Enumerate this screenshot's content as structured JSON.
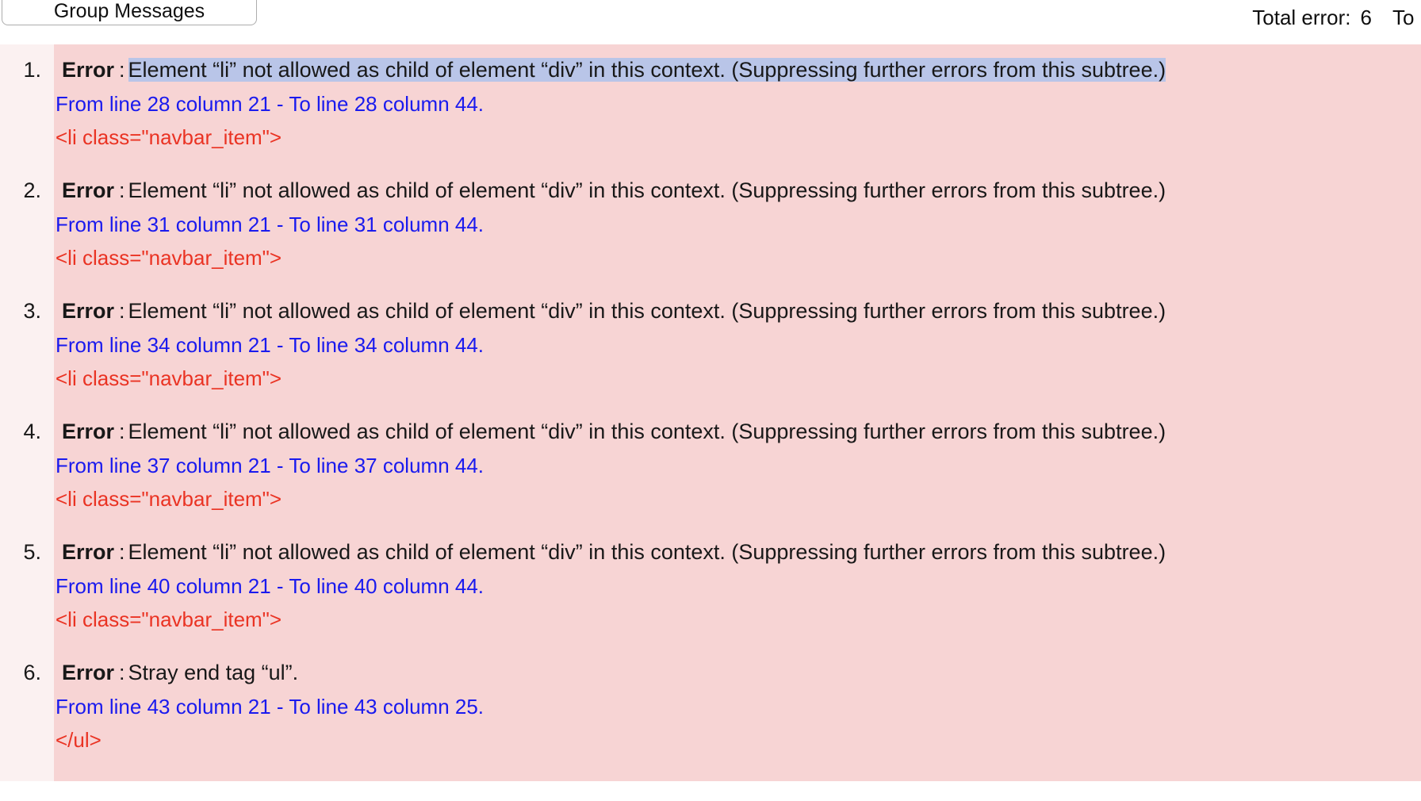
{
  "top_bar": {
    "tab_label": "Group Messages",
    "stats": [
      {
        "label": "Total error:",
        "value": "6"
      },
      {
        "label": "To",
        "value": ""
      }
    ],
    "total_error_label": "Total error:",
    "total_error_value": "6",
    "clipped_stat_label": "To"
  },
  "colors": {
    "error_background": "#f7d4d4",
    "gutter_background": "#fbf1f1",
    "selection_highlight": "#b9c5e8",
    "location_text": "#1a1aee",
    "extract_text": "#ea3323",
    "body_text": "#181818",
    "tab_border": "#adadad"
  },
  "errors": [
    {
      "index": "1.",
      "label": "Error",
      "separator": ":",
      "message": "Element “li” not allowed as child of element “div” in this context. (Suppressing further errors from this subtree.)",
      "location": "From line 28 column 21 - To line 28 column 44.",
      "extract": "<li class=\"navbar_item\">",
      "selected": true
    },
    {
      "index": "2.",
      "label": "Error",
      "separator": ":",
      "message": "Element “li” not allowed as child of element “div” in this context. (Suppressing further errors from this subtree.)",
      "location": "From line 31 column 21 - To line 31 column 44.",
      "extract": "<li class=\"navbar_item\">",
      "selected": false
    },
    {
      "index": "3.",
      "label": "Error",
      "separator": ":",
      "message": "Element “li” not allowed as child of element “div” in this context. (Suppressing further errors from this subtree.)",
      "location": "From line 34 column 21 - To line 34 column 44.",
      "extract": "<li class=\"navbar_item\">",
      "selected": false
    },
    {
      "index": "4.",
      "label": "Error",
      "separator": ":",
      "message": "Element “li” not allowed as child of element “div” in this context. (Suppressing further errors from this subtree.)",
      "location": "From line 37 column 21 - To line 37 column 44.",
      "extract": "<li class=\"navbar_item\">",
      "selected": false
    },
    {
      "index": "5.",
      "label": "Error",
      "separator": ":",
      "message": "Element “li” not allowed as child of element “div” in this context. (Suppressing further errors from this subtree.)",
      "location": "From line 40 column 21 - To line 40 column 44.",
      "extract": "<li class=\"navbar_item\">",
      "selected": false
    },
    {
      "index": "6.",
      "label": "Error",
      "separator": ":",
      "message": "Stray end tag “ul”.",
      "location": "From line 43 column 21 - To line 43 column 25.",
      "extract": "</ul>",
      "selected": false
    }
  ]
}
